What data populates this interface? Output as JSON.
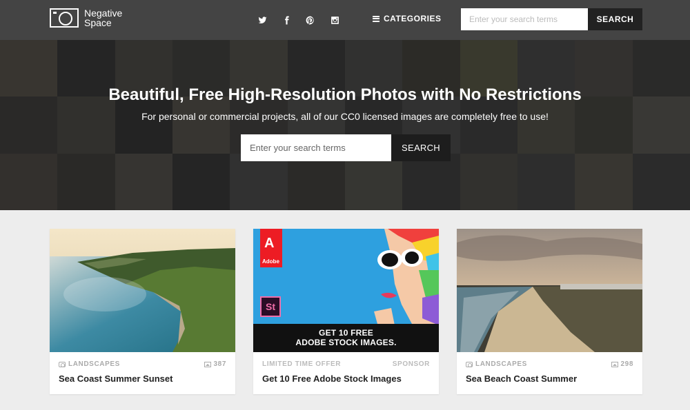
{
  "header": {
    "logo_line1": "Negative",
    "logo_line2": "Space",
    "social": [
      "twitter-icon",
      "facebook-icon",
      "pinterest-icon",
      "instagram-icon"
    ],
    "categories_label": "CATEGORIES",
    "search_placeholder": "Enter your search terms",
    "search_button": "SEARCH"
  },
  "hero": {
    "title": "Beautiful, Free High-Resolution Photos with No Restrictions",
    "subtitle": "For personal or commercial projects, all of our CC0 licensed images are completely free to use!",
    "search_placeholder": "Enter your search terms",
    "search_button": "SEARCH"
  },
  "cards": [
    {
      "category": "LANDSCAPES",
      "count": "387",
      "title": "Sea Coast Summer Sunset"
    },
    {
      "category": "LIMITED TIME OFFER",
      "count": "SPONSOR",
      "title": "Get 10 Free Adobe Stock Images",
      "ad_logo_text": "Adobe",
      "ad_logo_glyph": "A",
      "ad_product": "St",
      "ad_line1": "GET 10 FREE",
      "ad_line2": "ADOBE STOCK IMAGES."
    },
    {
      "category": "LANDSCAPES",
      "count": "298",
      "title": "Sea Beach Coast Summer"
    }
  ],
  "colors": {
    "header_bg": "#444444",
    "button_dark": "#222222",
    "page_bg": "#ededed",
    "ad_red": "#ed1c24",
    "ad_blue": "#2ea0df"
  }
}
